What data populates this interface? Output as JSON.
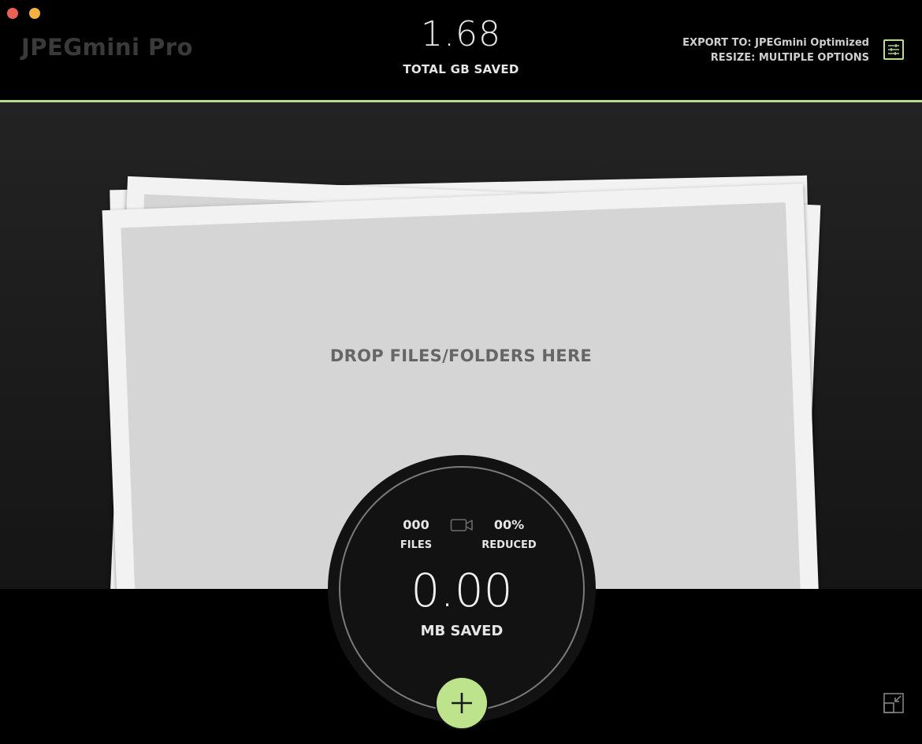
{
  "window": {
    "traffic_lights": [
      "close",
      "minimize"
    ],
    "colors": {
      "close": "#ee5f57",
      "minimize": "#f4b13e"
    }
  },
  "header": {
    "app_title": "JPEGmini Pro",
    "total_saved_value": "1.68",
    "total_saved_label": "TOTAL GB SAVED",
    "export_to": "EXPORT TO: JPEGmini Optimized",
    "resize": "RESIZE: MULTIPLE OPTIONS",
    "settings_icon": "sliders-icon"
  },
  "drop_zone": {
    "label": "DROP FILES/FOLDERS HERE"
  },
  "stats": {
    "files_value": "000",
    "files_label": "FILES",
    "reduced_value": "00%",
    "reduced_label": "REDUCED",
    "saved_value": "0.00",
    "saved_label": "MB SAVED",
    "video_icon": "video-camera-icon"
  },
  "actions": {
    "add_icon": "plus-icon",
    "collapse_icon": "collapse-window-icon"
  },
  "colors": {
    "accent": "#b9df86",
    "add_button": "#bde48c",
    "background": "#000000"
  }
}
